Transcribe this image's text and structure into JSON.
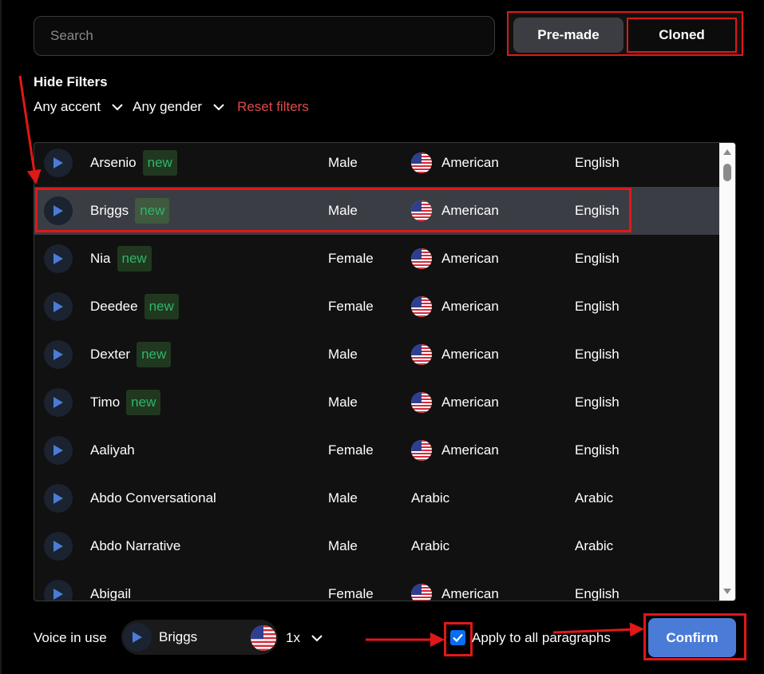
{
  "search": {
    "placeholder": "Search"
  },
  "tabs": {
    "premade": "Pre-made",
    "cloned": "Cloned"
  },
  "filters": {
    "hide_label": "Hide Filters",
    "accent": "Any accent",
    "gender": "Any gender",
    "reset": "Reset filters"
  },
  "voices": [
    {
      "name": "Arsenio",
      "badge": "new",
      "gender": "Male",
      "accent": "American",
      "flag": "us-flag-icon",
      "language": "English"
    },
    {
      "name": "Briggs",
      "badge": "new",
      "gender": "Male",
      "accent": "American",
      "flag": "us-flag-icon",
      "language": "English",
      "selected": true
    },
    {
      "name": "Nia",
      "badge": "new",
      "gender": "Female",
      "accent": "American",
      "flag": "us-flag-icon",
      "language": "English"
    },
    {
      "name": "Deedee",
      "badge": "new",
      "gender": "Female",
      "accent": "American",
      "flag": "us-flag-icon",
      "language": "English"
    },
    {
      "name": "Dexter",
      "badge": "new",
      "gender": "Male",
      "accent": "American",
      "flag": "us-flag-icon",
      "language": "English"
    },
    {
      "name": "Timo",
      "badge": "new",
      "gender": "Male",
      "accent": "American",
      "flag": "us-flag-icon",
      "language": "English"
    },
    {
      "name": "Aaliyah",
      "badge": "",
      "gender": "Female",
      "accent": "American",
      "flag": "us-flag-icon",
      "language": "English"
    },
    {
      "name": "Abdo Conversational",
      "badge": "",
      "gender": "Male",
      "accent": "Arabic",
      "flag": "",
      "language": "Arabic"
    },
    {
      "name": "Abdo Narrative",
      "badge": "",
      "gender": "Male",
      "accent": "Arabic",
      "flag": "",
      "language": "Arabic"
    },
    {
      "name": "Abigail",
      "badge": "",
      "gender": "Female",
      "accent": "American",
      "flag": "us-flag-icon",
      "language": "English"
    }
  ],
  "footer": {
    "voice_in_use_label": "Voice in use",
    "voice_name": "Briggs",
    "speed": "1x",
    "apply_label": "Apply to all paragraphs",
    "apply_checked": true,
    "confirm": "Confirm"
  },
  "colors": {
    "accent_blue": "#4a7bd6",
    "highlight_red": "#e01818",
    "reset_red": "#e0494b",
    "badge_green": "#2fb56b"
  }
}
